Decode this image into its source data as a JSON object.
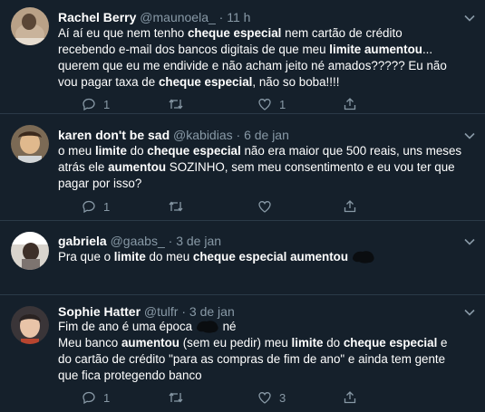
{
  "tweets": [
    {
      "name": "Rachel Berry",
      "handle": "@maunoela_",
      "dot": "·",
      "time": "11 h",
      "lines": [
        [
          {
            "t": "Aí aí eu que nem tenho "
          },
          {
            "t": "cheque especial",
            "b": true
          },
          {
            "t": " nem cartão de crédito"
          }
        ],
        [
          {
            "t": "recebendo e-mail dos bancos digitais de que meu "
          },
          {
            "t": "limite aumentou",
            "b": true
          },
          {
            "t": "..."
          }
        ],
        [
          {
            "t": "querem que eu me endivide e não acham jeito né amados????? Eu não"
          }
        ],
        [
          {
            "t": "vou pagar taxa de "
          },
          {
            "t": "cheque especial",
            "b": true
          },
          {
            "t": ", não so boba!!!!"
          }
        ]
      ],
      "reply_count": "1",
      "retweet_count": "",
      "like_count": "1",
      "share_count": ""
    },
    {
      "name": "karen don't be sad",
      "handle": "@kabidias",
      "dot": "·",
      "time": "6 de jan",
      "lines": [
        [
          {
            "t": "o meu "
          },
          {
            "t": "limite",
            "b": true
          },
          {
            "t": " do "
          },
          {
            "t": "cheque especial",
            "b": true
          },
          {
            "t": " não era maior que 500 reais, uns meses"
          }
        ],
        [
          {
            "t": "atrás ele "
          },
          {
            "t": "aumentou",
            "b": true
          },
          {
            "t": " SOZINHO, sem meu consentimento e eu vou ter que"
          }
        ],
        [
          {
            "t": "pagar por isso?"
          }
        ]
      ],
      "reply_count": "1",
      "retweet_count": "",
      "like_count": "",
      "share_count": ""
    },
    {
      "name": "gabriela",
      "handle": "@gaabs_",
      "dot": "·",
      "time": "3 de jan",
      "lines": [
        [
          {
            "t": "Pra que o "
          },
          {
            "t": "limite",
            "b": true
          },
          {
            "t": " do meu "
          },
          {
            "t": "cheque especial aumentou",
            "b": true
          }
        ]
      ],
      "reply_count": "",
      "retweet_count": "",
      "like_count": "",
      "share_count": ""
    },
    {
      "name": "Sophie Hatter",
      "handle": "@tulfr",
      "dot": "·",
      "time": "3 de jan",
      "lines": [
        [
          {
            "t": "Fim de ano é uma época "
          },
          {
            "t": " né"
          }
        ],
        [
          {
            "t": "Meu banco "
          },
          {
            "t": "aumentou",
            "b": true
          },
          {
            "t": " (sem eu pedir) meu "
          },
          {
            "t": "limite",
            "b": true
          },
          {
            "t": " do "
          },
          {
            "t": "cheque especial",
            "b": true
          },
          {
            "t": " e"
          }
        ],
        [
          {
            "t": "do cartão de crédito \"para as compras de fim de ano\" e ainda tem gente"
          }
        ],
        [
          {
            "t": "que fica protegendo banco"
          }
        ]
      ],
      "reply_count": "1",
      "retweet_count": "",
      "like_count": "3",
      "share_count": ""
    }
  ],
  "icons": {
    "reply": "reply-icon",
    "retweet": "retweet-icon",
    "like": "heart-icon",
    "share": "share-icon",
    "caret": "chevron-down-icon"
  },
  "colors": {
    "background": "#15202b",
    "muted": "#8899a6",
    "divider": "#2b3a48",
    "text": "#ffffff"
  }
}
